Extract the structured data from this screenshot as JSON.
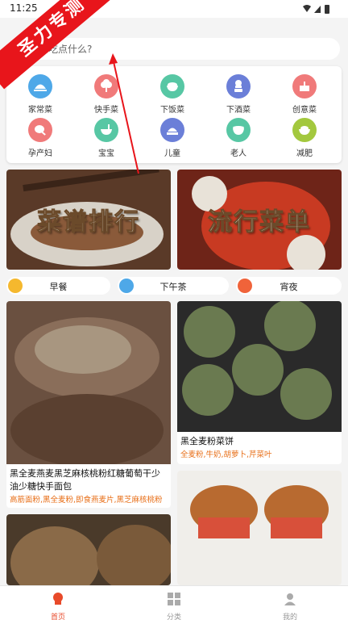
{
  "status": {
    "time": "11:25"
  },
  "watermark": "圣力专测",
  "search": {
    "placeholder": "想吃点什么?"
  },
  "categories": [
    {
      "label": "家常菜",
      "icon": "covered-dish-icon",
      "color": "#4ea8e8"
    },
    {
      "label": "快手菜",
      "icon": "broccoli-icon",
      "color": "#f07a7a"
    },
    {
      "label": "下饭菜",
      "icon": "rice-bowl-icon",
      "color": "#57c7a4"
    },
    {
      "label": "下酒菜",
      "icon": "chef-icon",
      "color": "#6b7fd8"
    },
    {
      "label": "创意菜",
      "icon": "cake-icon",
      "color": "#f07a7a"
    },
    {
      "label": "孕产妇",
      "icon": "meat-icon",
      "color": "#f07a7a"
    },
    {
      "label": "宝宝",
      "icon": "baby-bowl-icon",
      "color": "#57c7a4"
    },
    {
      "label": "儿童",
      "icon": "kids-dish-icon",
      "color": "#6b7fd8"
    },
    {
      "label": "老人",
      "icon": "elderly-bowl-icon",
      "color": "#57c7a4"
    },
    {
      "label": "减肥",
      "icon": "diet-bowl-icon",
      "color": "#a3c83e"
    }
  ],
  "banners": [
    {
      "title": "菜谱排行"
    },
    {
      "title": "流行菜单"
    }
  ],
  "meals": [
    {
      "label": "早餐",
      "color": "#f5b82e"
    },
    {
      "label": "下午茶",
      "color": "#4ea8e8"
    },
    {
      "label": "宵夜",
      "color": "#f0633a"
    }
  ],
  "recipes": [
    {
      "title": "黑全麦燕麦黑芝麻核桃粉红糖葡萄干少油少糖快手面包",
      "ingredients": "高筋面粉,黑全麦粉,即食燕麦片,黑芝麻核桃粉"
    },
    {
      "title": "黑全麦粉菜饼",
      "ingredients": "全麦粉,牛奶,胡萝卜,芹菜叶"
    }
  ],
  "tabs": [
    {
      "label": "首页"
    },
    {
      "label": "分类"
    },
    {
      "label": "我的"
    }
  ]
}
